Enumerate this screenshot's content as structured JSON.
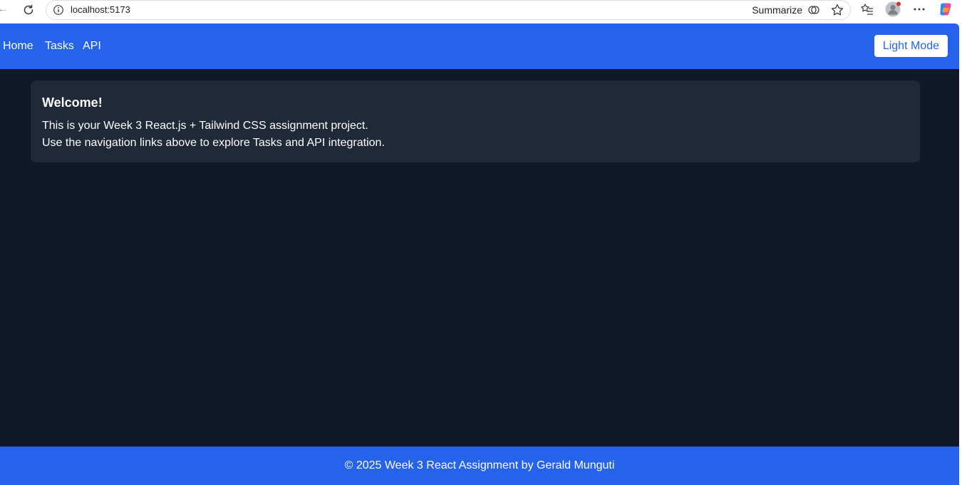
{
  "browser": {
    "url": "localhost:5173",
    "summarize_label": "Summarize"
  },
  "nav": {
    "links": [
      "Home",
      "Tasks",
      "API"
    ],
    "mode_button": "Light Mode"
  },
  "welcome": {
    "title": "Welcome!",
    "line1": "This is your Week 3 React.js + Tailwind CSS assignment project.",
    "line2": "Use the navigation links above to explore Tasks and API integration."
  },
  "footer": {
    "text": "© 2025 Week 3 React Assignment by Gerald Munguti"
  },
  "colors": {
    "primary": "#2563eb",
    "background": "#111827",
    "card": "#1f2937"
  }
}
